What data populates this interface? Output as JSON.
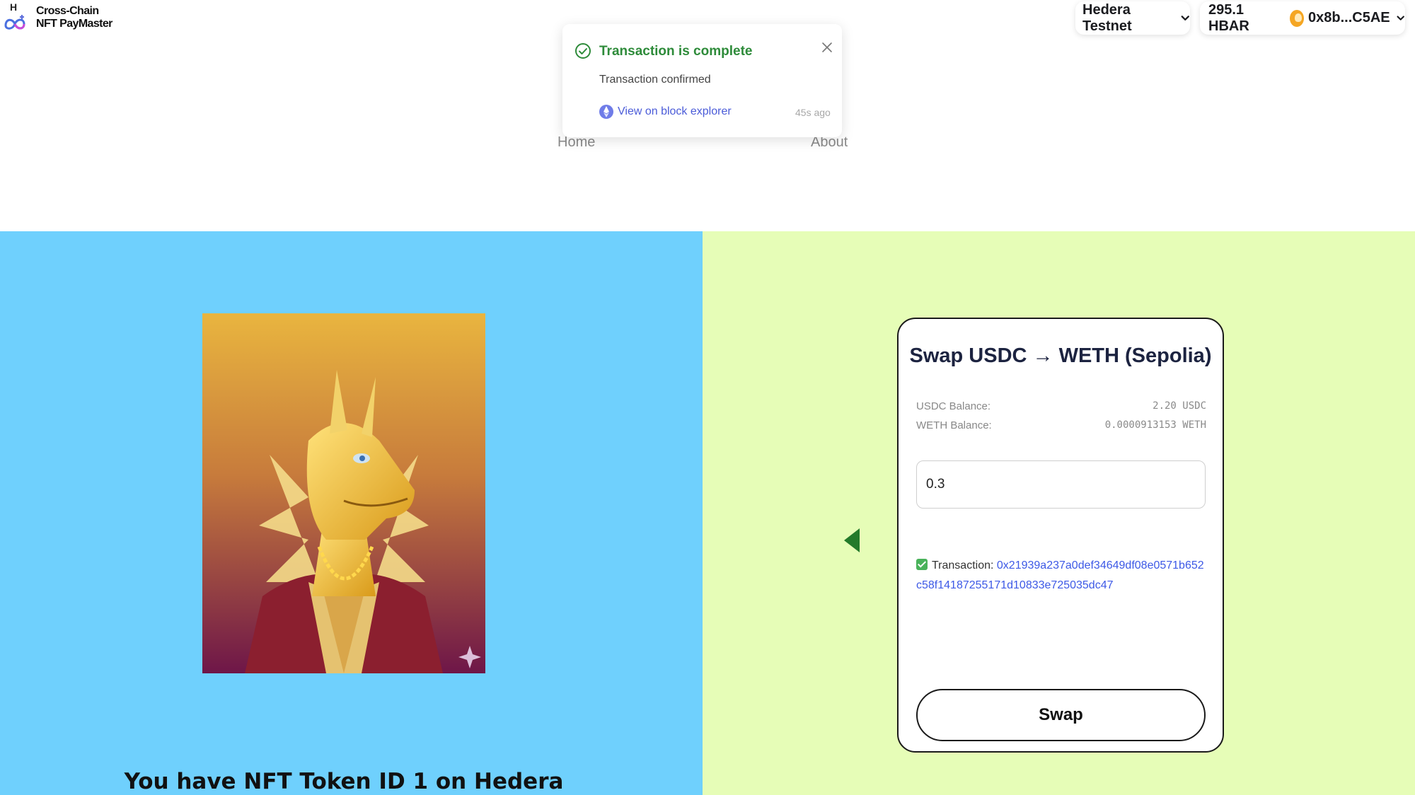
{
  "brand": {
    "line1": "Cross-Chain",
    "line2": "NFT PayMaster",
    "mark_letter": "H"
  },
  "header": {
    "network": "Hedera Testnet",
    "balance": "295.1 HBAR",
    "account": "0x8b...C5AE"
  },
  "nav": {
    "home": "Home",
    "about": "About"
  },
  "toast": {
    "title": "Transaction is complete",
    "message": "Transaction confirmed",
    "link": "View on block explorer",
    "time": "45s ago",
    "close_label": "X"
  },
  "nft": {
    "caption": "You have NFT Token ID 1 on Hedera"
  },
  "swap": {
    "title": "Swap USDC → WETH (Sepolia)",
    "usdc_label": "USDC Balance:",
    "usdc_value": "2.20 USDC",
    "weth_label": "WETH Balance:",
    "weth_value": "0.0000913153 WETH",
    "amount_value": "0.3",
    "tx_label": "Transaction:",
    "tx_hash": "0x21939a237a0def34649df08e0571b652c58f14187255171d10833e725035dc47",
    "button": "Swap"
  },
  "colors": {
    "left_bg": "#6fd0fd",
    "right_bg": "#e6fdb7",
    "success": "#2e8b3a",
    "link": "#3d59e6",
    "arrow": "#237a2a"
  }
}
